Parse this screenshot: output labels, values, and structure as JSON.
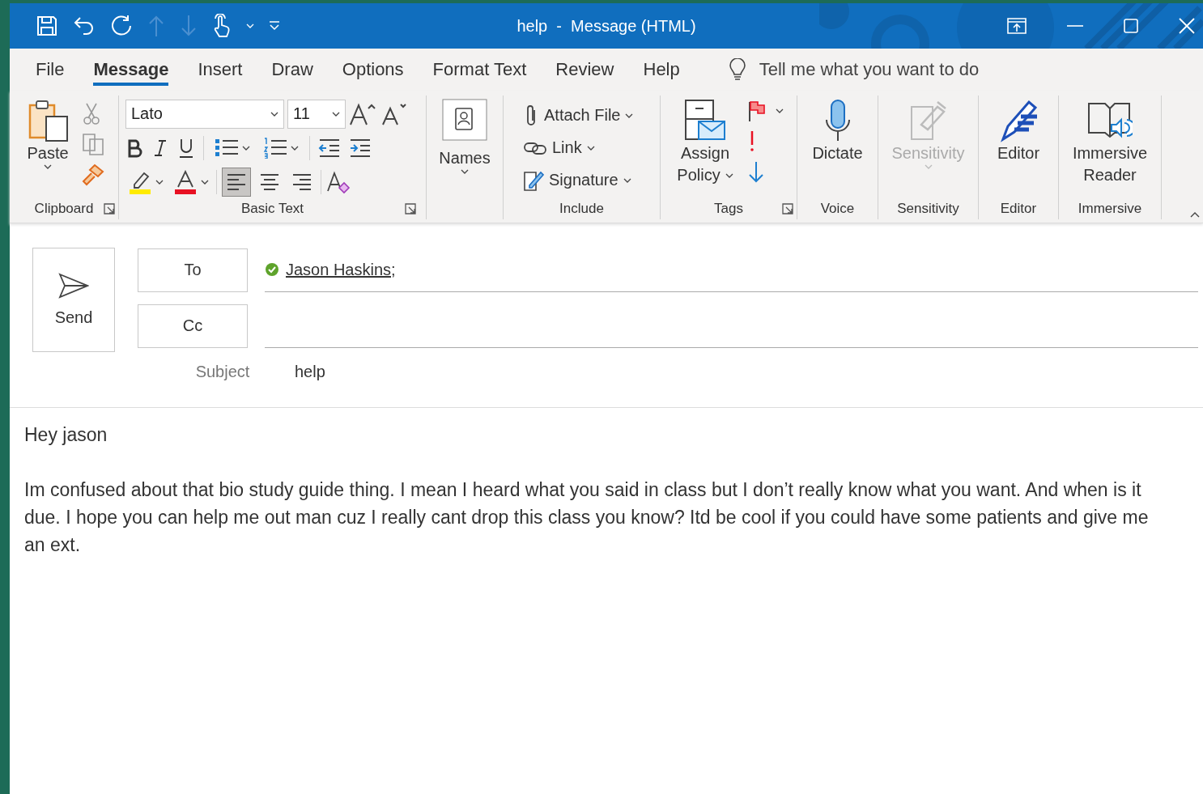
{
  "window": {
    "title": "help  -  Message (HTML)"
  },
  "tabs": [
    {
      "label": "File",
      "selected": false
    },
    {
      "label": "Message",
      "selected": true
    },
    {
      "label": "Insert",
      "selected": false
    },
    {
      "label": "Draw",
      "selected": false
    },
    {
      "label": "Options",
      "selected": false
    },
    {
      "label": "Format Text",
      "selected": false
    },
    {
      "label": "Review",
      "selected": false
    },
    {
      "label": "Help",
      "selected": false
    }
  ],
  "tell_me": {
    "placeholder": "Tell me what you want to do"
  },
  "ribbon": {
    "clipboard": {
      "label": "Clipboard",
      "paste": "Paste"
    },
    "basic_text": {
      "label": "Basic Text",
      "font": "Lato",
      "size": "11",
      "alignment": [
        {
          "kind": "left",
          "selected": true
        },
        {
          "kind": "center",
          "selected": false
        },
        {
          "kind": "right",
          "selected": false
        }
      ]
    },
    "names": {
      "button": "Names"
    },
    "include": {
      "label": "Include",
      "items": [
        "Attach File",
        "Link",
        "Signature"
      ]
    },
    "tags": {
      "label": "Tags",
      "button": [
        "Assign",
        "Policy"
      ]
    },
    "voice": {
      "label": "Voice",
      "button": "Dictate"
    },
    "sensitivity": {
      "label": "Sensitivity",
      "button": "Sensitivity",
      "disabled": true
    },
    "editor": {
      "label": "Editor",
      "button": "Editor"
    },
    "immersive": {
      "label": "Immersive",
      "button": [
        "Immersive",
        "Reader"
      ]
    }
  },
  "compose": {
    "send": "Send",
    "to_button": "To",
    "cc_button": "Cc",
    "recipients": [
      {
        "name": "Jason Haskins;",
        "resolved": true
      }
    ],
    "subject_label": "Subject",
    "subject": "help",
    "body": [
      "Hey jason",
      "Im confused about that bio study guide thing. I mean I heard what you said in class but I don’t really know what you want. And when is it due. I hope you can help me out man cuz I really cant drop this class you know? Itd be cool if you could have some patients and give me an ext."
    ]
  }
}
